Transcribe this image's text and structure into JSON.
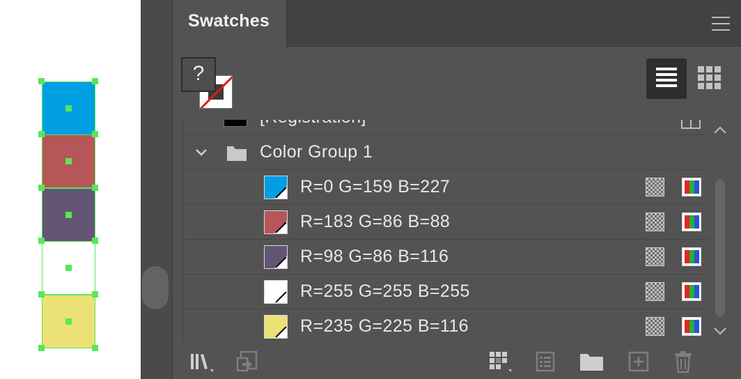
{
  "panel": {
    "tab_title": "Swatches",
    "unknown_fill_label": "?"
  },
  "swatches": {
    "partial_top_row": "[Registration]",
    "group_name": "Color Group 1",
    "items": [
      {
        "label": "R=0 G=159 B=227",
        "color": "#009fe3"
      },
      {
        "label": "R=183 G=86 B=88",
        "color": "#b75658"
      },
      {
        "label": "R=98 G=86 B=116",
        "color": "#625674"
      },
      {
        "label": "R=255 G=255 B=255",
        "color": "#ffffff"
      },
      {
        "label": "R=235 G=225 B=116",
        "color": "#ebe174"
      }
    ]
  },
  "artboard": {
    "selection_color": "#5ae65a",
    "squares": [
      "#009fe3",
      "#b75658",
      "#625674",
      "#ffffff",
      "#ebe174"
    ]
  },
  "toolbar_icons": [
    "swatch-libraries-icon",
    "place-swatch-icon",
    "show-swatch-kinds-icon",
    "swatch-options-icon",
    "new-color-group-icon",
    "new-swatch-icon",
    "delete-swatch-icon"
  ]
}
